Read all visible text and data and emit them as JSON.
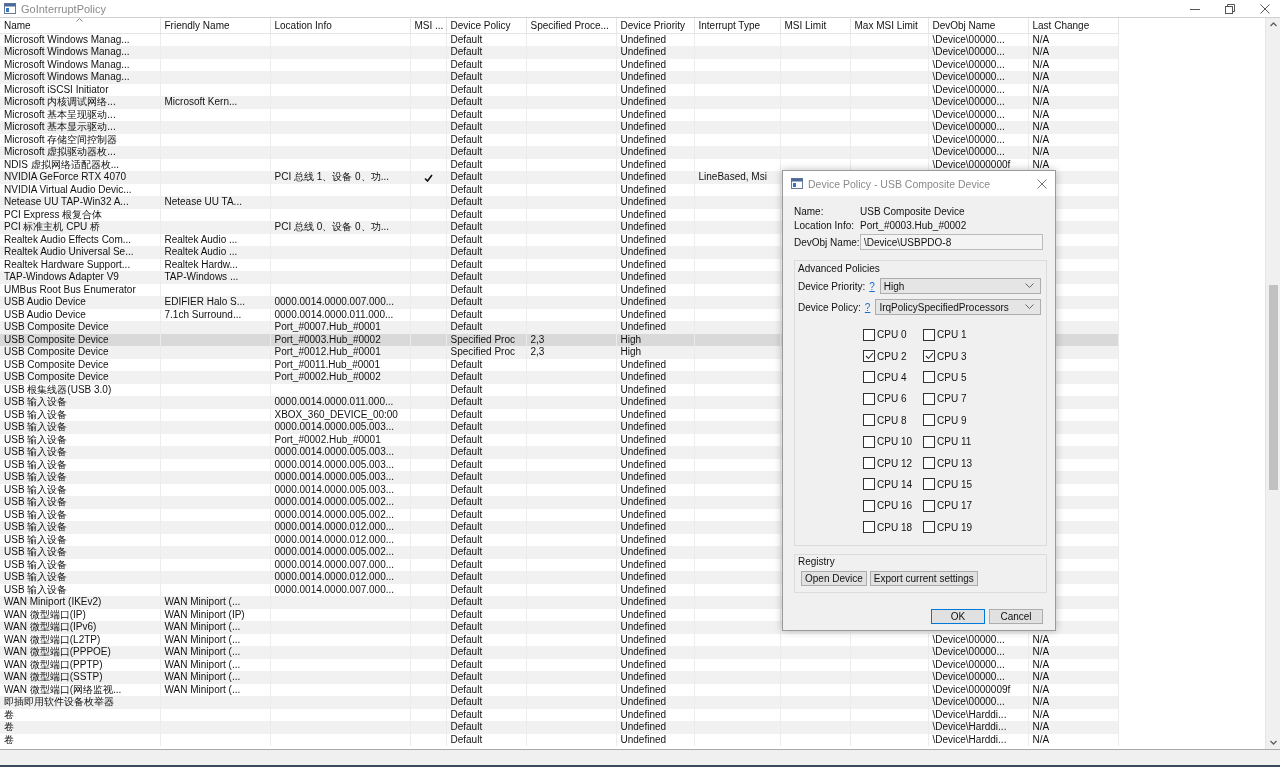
{
  "window": {
    "title": "GoInterruptPolicy"
  },
  "table": {
    "columns": [
      {
        "label": "Name",
        "sorted": true
      },
      {
        "label": "Friendly Name",
        "sorted": false
      },
      {
        "label": "Location Info",
        "sorted": false
      },
      {
        "label": "MSI ...",
        "sorted": false
      },
      {
        "label": "Device Policy",
        "sorted": false
      },
      {
        "label": "Specified Proce...",
        "sorted": false
      },
      {
        "label": "Device Priority",
        "sorted": false
      },
      {
        "label": "Interrupt Type",
        "sorted": false
      },
      {
        "label": "MSI Limit",
        "sorted": false
      },
      {
        "label": "Max MSI Limit",
        "sorted": false
      },
      {
        "label": "DevObj Name",
        "sorted": false
      },
      {
        "label": "Last Change",
        "sorted": false
      }
    ],
    "rows": [
      {
        "name": "Microsoft Windows Manag...",
        "msi": false,
        "device_policy": "Default",
        "device_priority": "Undefined",
        "devobj_name": "\\Device\\00000...",
        "last_change": "N/A",
        "selected": false
      },
      {
        "name": "Microsoft Windows Manag...",
        "msi": false,
        "device_policy": "Default",
        "device_priority": "Undefined",
        "devobj_name": "\\Device\\00000...",
        "last_change": "N/A",
        "selected": false
      },
      {
        "name": "Microsoft Windows Manag...",
        "msi": false,
        "device_policy": "Default",
        "device_priority": "Undefined",
        "devobj_name": "\\Device\\00000...",
        "last_change": "N/A",
        "selected": false
      },
      {
        "name": "Microsoft Windows Manag...",
        "msi": false,
        "device_policy": "Default",
        "device_priority": "Undefined",
        "devobj_name": "\\Device\\00000...",
        "last_change": "N/A",
        "selected": false
      },
      {
        "name": "Microsoft iSCSI Initiator",
        "msi": false,
        "device_policy": "Default",
        "device_priority": "Undefined",
        "devobj_name": "\\Device\\00000...",
        "last_change": "N/A",
        "selected": false
      },
      {
        "name": "Microsoft 内核调试网络...",
        "friendly_name": "Microsoft Kern...",
        "msi": false,
        "device_policy": "Default",
        "device_priority": "Undefined",
        "devobj_name": "\\Device\\00000...",
        "last_change": "N/A",
        "selected": false
      },
      {
        "name": "Microsoft 基本呈现驱动...",
        "msi": false,
        "device_policy": "Default",
        "device_priority": "Undefined",
        "devobj_name": "\\Device\\00000...",
        "last_change": "N/A",
        "selected": false
      },
      {
        "name": "Microsoft 基本显示驱动...",
        "msi": false,
        "device_policy": "Default",
        "device_priority": "Undefined",
        "devobj_name": "\\Device\\00000...",
        "last_change": "N/A",
        "selected": false
      },
      {
        "name": "Microsoft 存储空间控制器",
        "msi": false,
        "device_policy": "Default",
        "device_priority": "Undefined",
        "devobj_name": "\\Device\\00000...",
        "last_change": "N/A",
        "selected": false
      },
      {
        "name": "Microsoft 虚拟驱动器枚...",
        "msi": false,
        "device_policy": "Default",
        "device_priority": "Undefined",
        "devobj_name": "\\Device\\00000...",
        "last_change": "N/A",
        "selected": false
      },
      {
        "name": "NDIS 虚拟网络适配器枚...",
        "msi": false,
        "device_policy": "Default",
        "device_priority": "Undefined",
        "devobj_name": "\\Device\\0000000f",
        "last_change": "N/A",
        "selected": false
      },
      {
        "name": "NVIDIA GeForce RTX 4070",
        "location_info": "PCI 总线 1、设备 0、功...",
        "msi": true,
        "device_policy": "Default",
        "device_priority": "Undefined",
        "interrupt_type": "LineBased, Msi",
        "selected": false
      },
      {
        "name": "NVIDIA Virtual Audio Devic...",
        "msi": false,
        "device_policy": "Default",
        "device_priority": "Undefined",
        "selected": false
      },
      {
        "name": "Netease UU TAP-Win32 A...",
        "friendly_name": "Netease UU TA...",
        "msi": false,
        "device_policy": "Default",
        "device_priority": "Undefined",
        "selected": false
      },
      {
        "name": "PCI Express 根复合体",
        "msi": false,
        "device_policy": "Default",
        "device_priority": "Undefined",
        "selected": false
      },
      {
        "name": "PCI 标准主机 CPU 桥",
        "location_info": "PCI 总线 0、设备 0、功...",
        "msi": false,
        "device_policy": "Default",
        "device_priority": "Undefined",
        "selected": false
      },
      {
        "name": "Realtek Audio Effects Com...",
        "friendly_name": "Realtek Audio ...",
        "msi": false,
        "device_policy": "Default",
        "device_priority": "Undefined",
        "selected": false
      },
      {
        "name": "Realtek Audio Universal Se...",
        "friendly_name": "Realtek Audio ...",
        "msi": false,
        "device_policy": "Default",
        "device_priority": "Undefined",
        "selected": false
      },
      {
        "name": "Realtek Hardware Support...",
        "friendly_name": "Realtek Hardw...",
        "msi": false,
        "device_policy": "Default",
        "device_priority": "Undefined",
        "selected": false
      },
      {
        "name": "TAP-Windows Adapter V9",
        "friendly_name": "TAP-Windows ...",
        "msi": false,
        "device_policy": "Default",
        "device_priority": "Undefined",
        "selected": false
      },
      {
        "name": "UMBus Root Bus Enumerator",
        "msi": false,
        "device_policy": "Default",
        "device_priority": "Undefined",
        "selected": false
      },
      {
        "name": "USB Audio Device",
        "friendly_name": "EDIFIER Halo S...",
        "location_info": "0000.0014.0000.007.000...",
        "msi": false,
        "device_policy": "Default",
        "device_priority": "Undefined",
        "selected": false
      },
      {
        "name": "USB Audio Device",
        "friendly_name": "7.1ch Surround...",
        "location_info": "0000.0014.0000.011.000...",
        "msi": false,
        "device_policy": "Default",
        "device_priority": "Undefined",
        "selected": false
      },
      {
        "name": "USB Composite Device",
        "location_info": "Port_#0007.Hub_#0001",
        "msi": false,
        "device_policy": "Default",
        "device_priority": "Undefined",
        "selected": false
      },
      {
        "name": "USB Composite Device",
        "location_info": "Port_#0003.Hub_#0002",
        "msi": false,
        "device_policy": "Specified Proc",
        "specified_processors": "2,3",
        "device_priority": "High",
        "selected": true
      },
      {
        "name": "USB Composite Device",
        "location_info": "Port_#0012.Hub_#0001",
        "msi": false,
        "device_policy": "Specified Proc",
        "specified_processors": "2,3",
        "device_priority": "High",
        "selected": false
      },
      {
        "name": "USB Composite Device",
        "location_info": "Port_#0011.Hub_#0001",
        "msi": false,
        "device_policy": "Default",
        "device_priority": "Undefined",
        "selected": false
      },
      {
        "name": "USB Composite Device",
        "location_info": "Port_#0002.Hub_#0002",
        "msi": false,
        "device_policy": "Default",
        "device_priority": "Undefined",
        "selected": false
      },
      {
        "name": "USB 根集线器(USB 3.0)",
        "msi": false,
        "device_policy": "Default",
        "device_priority": "Undefined",
        "selected": false
      },
      {
        "name": "USB 输入设备",
        "location_info": "0000.0014.0000.011.000...",
        "msi": false,
        "device_policy": "Default",
        "device_priority": "Undefined",
        "selected": false
      },
      {
        "name": "USB 输入设备",
        "location_info": "XBOX_360_DEVICE_00:00",
        "msi": false,
        "device_policy": "Default",
        "device_priority": "Undefined",
        "selected": false
      },
      {
        "name": "USB 输入设备",
        "location_info": "0000.0014.0000.005.003...",
        "msi": false,
        "device_policy": "Default",
        "device_priority": "Undefined",
        "selected": false
      },
      {
        "name": "USB 输入设备",
        "location_info": "Port_#0002.Hub_#0001",
        "msi": false,
        "device_policy": "Default",
        "device_priority": "Undefined",
        "selected": false
      },
      {
        "name": "USB 输入设备",
        "location_info": "0000.0014.0000.005.003...",
        "msi": false,
        "device_policy": "Default",
        "device_priority": "Undefined",
        "selected": false
      },
      {
        "name": "USB 输入设备",
        "location_info": "0000.0014.0000.005.003...",
        "msi": false,
        "device_policy": "Default",
        "device_priority": "Undefined",
        "selected": false
      },
      {
        "name": "USB 输入设备",
        "location_info": "0000.0014.0000.005.003...",
        "msi": false,
        "device_policy": "Default",
        "device_priority": "Undefined",
        "selected": false
      },
      {
        "name": "USB 输入设备",
        "location_info": "0000.0014.0000.005.003...",
        "msi": false,
        "device_policy": "Default",
        "device_priority": "Undefined",
        "selected": false
      },
      {
        "name": "USB 输入设备",
        "location_info": "0000.0014.0000.005.002...",
        "msi": false,
        "device_policy": "Default",
        "device_priority": "Undefined",
        "selected": false
      },
      {
        "name": "USB 输入设备",
        "location_info": "0000.0014.0000.005.002...",
        "msi": false,
        "device_policy": "Default",
        "device_priority": "Undefined",
        "selected": false
      },
      {
        "name": "USB 输入设备",
        "location_info": "0000.0014.0000.012.000...",
        "msi": false,
        "device_policy": "Default",
        "device_priority": "Undefined",
        "selected": false
      },
      {
        "name": "USB 输入设备",
        "location_info": "0000.0014.0000.012.000...",
        "msi": false,
        "device_policy": "Default",
        "device_priority": "Undefined",
        "selected": false
      },
      {
        "name": "USB 输入设备",
        "location_info": "0000.0014.0000.005.002...",
        "msi": false,
        "device_policy": "Default",
        "device_priority": "Undefined",
        "selected": false
      },
      {
        "name": "USB 输入设备",
        "location_info": "0000.0014.0000.007.000...",
        "msi": false,
        "device_policy": "Default",
        "device_priority": "Undefined",
        "selected": false
      },
      {
        "name": "USB 输入设备",
        "location_info": "0000.0014.0000.012.000...",
        "msi": false,
        "device_policy": "Default",
        "device_priority": "Undefined",
        "selected": false
      },
      {
        "name": "USB 输入设备",
        "location_info": "0000.0014.0000.007.000...",
        "msi": false,
        "device_policy": "Default",
        "device_priority": "Undefined",
        "selected": false
      },
      {
        "name": "WAN Miniport (IKEv2)",
        "friendly_name": "WAN Miniport (...",
        "msi": false,
        "device_policy": "Default",
        "device_priority": "Undefined",
        "selected": false
      },
      {
        "name": "WAN 微型端口(IP)",
        "friendly_name": "WAN Miniport (IP)",
        "msi": false,
        "device_policy": "Default",
        "device_priority": "Undefined",
        "selected": false
      },
      {
        "name": "WAN 微型端口(IPv6)",
        "friendly_name": "WAN Miniport (...",
        "msi": false,
        "device_policy": "Default",
        "device_priority": "Undefined",
        "selected": false
      },
      {
        "name": "WAN 微型端口(L2TP)",
        "friendly_name": "WAN Miniport (...",
        "msi": false,
        "device_policy": "Default",
        "device_priority": "Undefined",
        "devobj_name": "\\Device\\00000...",
        "last_change": "N/A",
        "selected": false
      },
      {
        "name": "WAN 微型端口(PPPOE)",
        "friendly_name": "WAN Miniport (...",
        "msi": false,
        "device_policy": "Default",
        "device_priority": "Undefined",
        "devobj_name": "\\Device\\00000...",
        "last_change": "N/A",
        "selected": false
      },
      {
        "name": "WAN 微型端口(PPTP)",
        "friendly_name": "WAN Miniport (...",
        "msi": false,
        "device_policy": "Default",
        "device_priority": "Undefined",
        "devobj_name": "\\Device\\00000...",
        "last_change": "N/A",
        "selected": false
      },
      {
        "name": "WAN 微型端口(SSTP)",
        "friendly_name": "WAN Miniport (...",
        "msi": false,
        "device_policy": "Default",
        "device_priority": "Undefined",
        "devobj_name": "\\Device\\00000...",
        "last_change": "N/A",
        "selected": false
      },
      {
        "name": "WAN 微型端口(网络监视...",
        "friendly_name": "WAN Miniport (...",
        "msi": false,
        "device_policy": "Default",
        "device_priority": "Undefined",
        "devobj_name": "\\Device\\0000009f",
        "last_change": "N/A",
        "selected": false
      },
      {
        "name": "即插即用软件设备枚举器",
        "msi": false,
        "device_policy": "Default",
        "device_priority": "Undefined",
        "devobj_name": "\\Device\\00000...",
        "last_change": "N/A",
        "selected": false
      },
      {
        "name": "卷",
        "msi": false,
        "device_policy": "Default",
        "device_priority": "Undefined",
        "devobj_name": "\\Device\\Harddi...",
        "last_change": "N/A",
        "selected": false
      },
      {
        "name": "卷",
        "msi": false,
        "device_policy": "Default",
        "device_priority": "Undefined",
        "devobj_name": "\\Device\\Harddi...",
        "last_change": "N/A",
        "selected": false
      },
      {
        "name": "卷",
        "msi": false,
        "device_policy": "Default",
        "device_priority": "Undefined",
        "devobj_name": "\\Device\\Harddi...",
        "last_change": "N/A",
        "selected": false
      }
    ]
  },
  "dialog": {
    "title": "Device Policy - USB Composite Device",
    "fields": [
      {
        "label": "Name:",
        "value": "USB Composite Device",
        "kind": "text"
      },
      {
        "label": "Location Info:",
        "value": "Port_#0003.Hub_#0002",
        "kind": "text"
      },
      {
        "label": "DevObj Name:",
        "value": "\\Device\\USBPDO-8",
        "kind": "input"
      }
    ],
    "advanced": {
      "title": "Advanced Policies",
      "selects": [
        {
          "label": "Device Priority:",
          "help": "?",
          "value": "High"
        },
        {
          "label": "Device Policy:",
          "help": "?",
          "value": "IrqPolicySpecifiedProcessors"
        }
      ],
      "cpus": [
        {
          "label": "CPU 0",
          "checked": false
        },
        {
          "label": "CPU 1",
          "checked": false
        },
        {
          "label": "CPU 2",
          "checked": true
        },
        {
          "label": "CPU 3",
          "checked": true
        },
        {
          "label": "CPU 4",
          "checked": false
        },
        {
          "label": "CPU 5",
          "checked": false
        },
        {
          "label": "CPU 6",
          "checked": false
        },
        {
          "label": "CPU 7",
          "checked": false
        },
        {
          "label": "CPU 8",
          "checked": false
        },
        {
          "label": "CPU 9",
          "checked": false
        },
        {
          "label": "CPU 10",
          "checked": false
        },
        {
          "label": "CPU 11",
          "checked": false
        },
        {
          "label": "CPU 12",
          "checked": false
        },
        {
          "label": "CPU 13",
          "checked": false
        },
        {
          "label": "CPU 14",
          "checked": false
        },
        {
          "label": "CPU 15",
          "checked": false
        },
        {
          "label": "CPU 16",
          "checked": false
        },
        {
          "label": "CPU 17",
          "checked": false
        },
        {
          "label": "CPU 18",
          "checked": false
        },
        {
          "label": "CPU 19",
          "checked": false
        }
      ]
    },
    "registry": {
      "title": "Registry",
      "buttons": [
        "Open Device",
        "Export current settings"
      ]
    },
    "buttons": [
      {
        "label": "OK",
        "default": true
      },
      {
        "label": "Cancel",
        "default": false
      }
    ]
  }
}
